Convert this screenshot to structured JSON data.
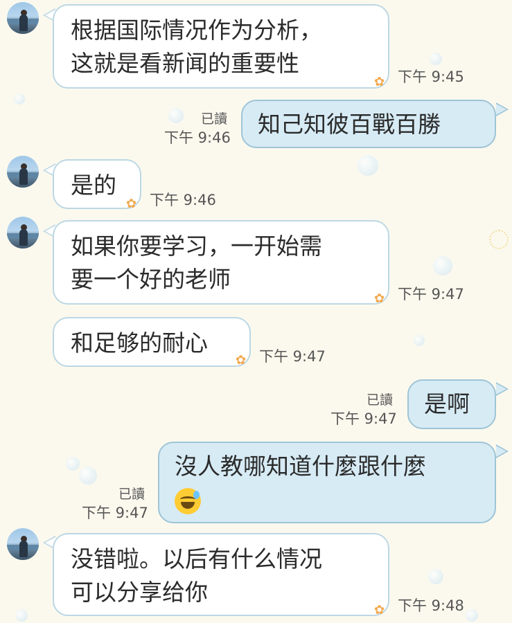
{
  "colors": {
    "background": "#fbf9ee",
    "incoming_bubble": "#ffffff",
    "outgoing_bubble": "#d7ebf5",
    "bubble_border": "#bcd7e4"
  },
  "messages": [
    {
      "side": "in",
      "lines": [
        "根据国际情况作为分析，",
        "这就是看新闻的重要性"
      ],
      "time": "下午 9:45"
    },
    {
      "side": "out",
      "lines": [
        "知己知彼百戰百勝"
      ],
      "read": "已讀",
      "time": "下午 9:46"
    },
    {
      "side": "in",
      "lines": [
        "是的"
      ],
      "time": "下午 9:46"
    },
    {
      "side": "in",
      "lines": [
        "如果你要学习，一开始需",
        "要一个好的老师"
      ],
      "time": "下午 9:47"
    },
    {
      "side": "in",
      "lines": [
        "和足够的耐心"
      ],
      "time": "下午 9:47"
    },
    {
      "side": "out",
      "lines": [
        "是啊"
      ],
      "read": "已讀",
      "time": "下午 9:47"
    },
    {
      "side": "out",
      "lines": [
        "沒人教哪知道什麼跟什麼"
      ],
      "emoji": "grinning-sweat-emoji",
      "read": "已讀",
      "time": "下午 9:47"
    },
    {
      "side": "in",
      "lines": [
        "没错啦。以后有什么情况",
        "可以分享给你"
      ],
      "time": "下午 9:48"
    }
  ]
}
